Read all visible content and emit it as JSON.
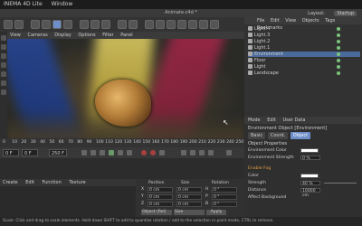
{
  "menubar": {
    "app": "INEMA 4D Lite",
    "window": "Window"
  },
  "title": "Animate.c4d *",
  "layout": {
    "label": "Layout:",
    "value": "Startup"
  },
  "viewport_menu": [
    "View",
    "Cameras",
    "Display",
    "Options",
    "Filter",
    "Panel"
  ],
  "object_panel": {
    "tabs": [
      "File",
      "Edit",
      "View",
      "Objects",
      "Tags",
      "Bookmarks"
    ],
    "objects": [
      {
        "name": "Light.4",
        "selected": false
      },
      {
        "name": "Light.3",
        "selected": false
      },
      {
        "name": "Light.2",
        "selected": false
      },
      {
        "name": "Light.1",
        "selected": false
      },
      {
        "name": "Environment",
        "selected": true
      },
      {
        "name": "Floor",
        "selected": false
      },
      {
        "name": "Light",
        "selected": false
      },
      {
        "name": "Landscape",
        "selected": false
      }
    ]
  },
  "attributes": {
    "menu": [
      "Mode",
      "Edit",
      "User Data"
    ],
    "title": "Environment Object [Environment]",
    "tabs": [
      "Basic",
      "Coord.",
      "Object"
    ],
    "active_tab": "Object",
    "section": "Object Properties",
    "env_color_label": "Environment Color",
    "env_strength_label": "Environment Strength",
    "env_strength_value": "0 %",
    "fog_label": "Enable Fog",
    "color_label": "Color",
    "fog_strength_label": "Strength",
    "fog_strength_value": "40 %",
    "distance_label": "Distance",
    "distance_value": "10000 cm",
    "affect_bg_label": "Affect Background"
  },
  "timeline": {
    "ticks": [
      "0",
      "10",
      "20",
      "30",
      "40",
      "50",
      "60",
      "70",
      "80",
      "90",
      "100",
      "110",
      "120",
      "130",
      "140",
      "150",
      "160",
      "170",
      "180",
      "190",
      "200",
      "210",
      "220",
      "230",
      "240",
      "250"
    ],
    "start_field": "0 F",
    "current_field": "0 F",
    "end_field": "250 F"
  },
  "material_menu": [
    "Create",
    "Edit",
    "Function",
    "Texture"
  ],
  "coordinates": {
    "headers": [
      "Position",
      "Size",
      "Rotation"
    ],
    "rows": [
      {
        "axis": "X",
        "pos": "0 cm",
        "size": "0 cm",
        "rot_axis": "H",
        "rot": "0 °"
      },
      {
        "axis": "Y",
        "pos": "0 cm",
        "size": "0 cm",
        "rot_axis": "P",
        "rot": "0 °"
      },
      {
        "axis": "Z",
        "pos": "0 cm",
        "size": "0 cm",
        "rot_axis": "B",
        "rot": "0 °"
      }
    ],
    "mode_select": "Object (Rel)",
    "size_select": "Size",
    "apply_label": "Apply"
  },
  "status": "Scale: Click and drag to scale elements. Hold down SHIFT to add to quantize rotation / add to the selection in point mode, CTRL to remove.",
  "colors": {
    "accent": "#6d8ec9",
    "selection": "#4a6a9a",
    "panel": "#2f2f2f"
  }
}
